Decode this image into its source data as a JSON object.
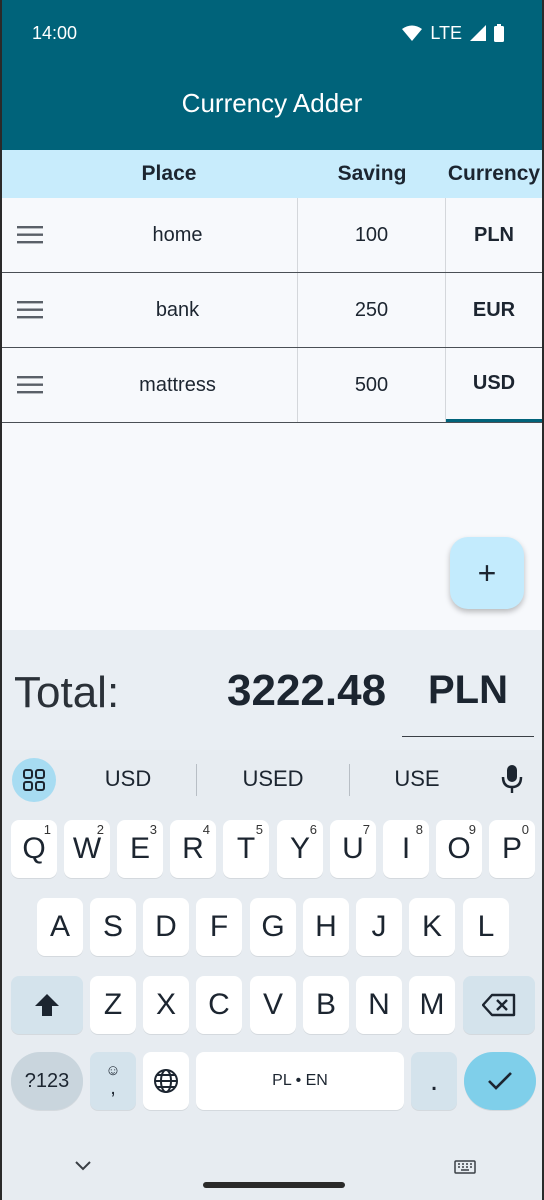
{
  "status": {
    "time": "14:00",
    "network": "LTE"
  },
  "app": {
    "title": "Currency Adder"
  },
  "table": {
    "headers": {
      "place": "Place",
      "saving": "Saving",
      "currency": "Currency"
    },
    "rows": [
      {
        "place": "home",
        "saving": "100",
        "currency": "PLN"
      },
      {
        "place": "bank",
        "saving": "250",
        "currency": "EUR"
      },
      {
        "place": "mattress",
        "saving": "500",
        "currency": "USD"
      }
    ]
  },
  "fab": {
    "label": "+"
  },
  "total": {
    "label": "Total:",
    "amount": "3222.48",
    "currency": "PLN"
  },
  "keyboard": {
    "suggestions": [
      "USD",
      "USED",
      "USE"
    ],
    "row1": [
      {
        "k": "Q",
        "n": "1"
      },
      {
        "k": "W",
        "n": "2"
      },
      {
        "k": "E",
        "n": "3"
      },
      {
        "k": "R",
        "n": "4"
      },
      {
        "k": "T",
        "n": "5"
      },
      {
        "k": "Y",
        "n": "6"
      },
      {
        "k": "U",
        "n": "7"
      },
      {
        "k": "I",
        "n": "8"
      },
      {
        "k": "O",
        "n": "9"
      },
      {
        "k": "P",
        "n": "0"
      }
    ],
    "row2": [
      "A",
      "S",
      "D",
      "F",
      "G",
      "H",
      "J",
      "K",
      "L"
    ],
    "row3": [
      "Z",
      "X",
      "C",
      "V",
      "B",
      "N",
      "M"
    ],
    "symbols_label": "?123",
    "emoji_comma": ",",
    "space_label": "PL • EN",
    "period": "."
  }
}
